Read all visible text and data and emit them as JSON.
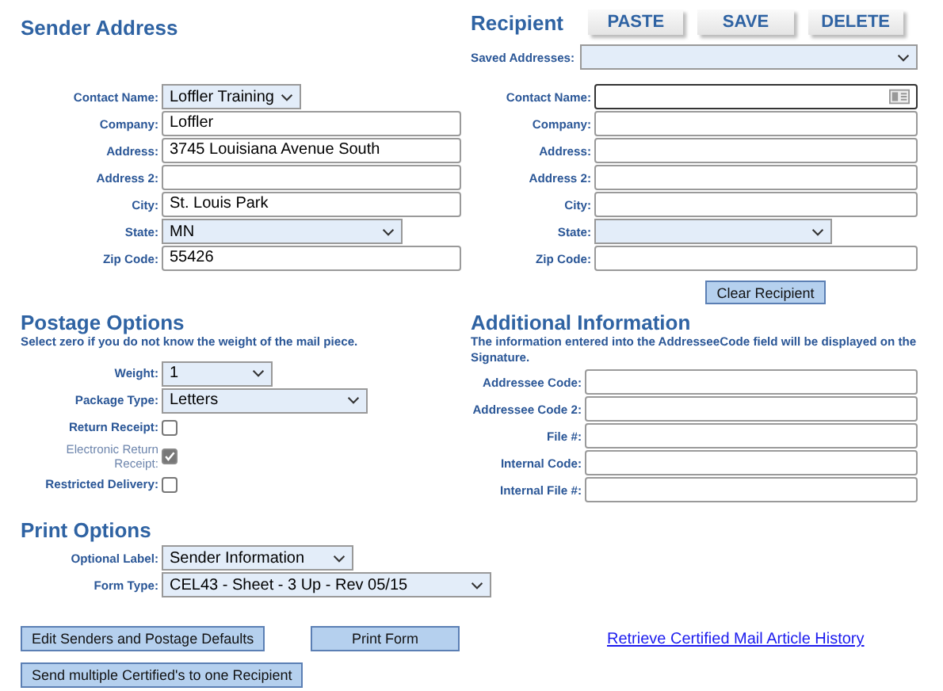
{
  "sender": {
    "title": "Sender Address",
    "fields": [
      {
        "label": "Contact Name:",
        "kind": "select",
        "value": "Loffler Training"
      },
      {
        "label": "Company:",
        "kind": "text",
        "value": "Loffler"
      },
      {
        "label": "Address:",
        "kind": "text",
        "value": "3745 Louisiana Avenue South"
      },
      {
        "label": "Address 2:",
        "kind": "text"
      },
      {
        "label": "City:",
        "kind": "text",
        "value": "St. Louis Park"
      },
      {
        "label": "State:",
        "kind": "select",
        "value": "MN"
      },
      {
        "label": "Zip Code:",
        "kind": "text",
        "value": "55426"
      }
    ]
  },
  "recipient": {
    "title": "Recipient",
    "buttons": [
      "PASTE",
      "SAVE",
      "DELETE"
    ],
    "saved_addresses": {
      "label": "Saved Addresses:"
    },
    "fields": [
      {
        "label": "Contact Name:",
        "kind": "contact"
      },
      {
        "label": "Company:",
        "kind": "text"
      },
      {
        "label": "Address:",
        "kind": "text"
      },
      {
        "label": "Address 2:",
        "kind": "text"
      },
      {
        "label": "City:",
        "kind": "text"
      },
      {
        "label": "State:",
        "kind": "select"
      },
      {
        "label": "Zip Code:",
        "kind": "text"
      }
    ],
    "clear_button": "Clear Recipient"
  },
  "postage_options": {
    "title": "Postage Options",
    "note": "Select zero if you do not know the weight of the mail piece.",
    "fields": [
      {
        "label": "Weight:",
        "kind": "select",
        "value": "1"
      },
      {
        "label": "Package Type:",
        "kind": "select",
        "value": "Letters"
      },
      {
        "label": "Return Receipt:",
        "kind": "checkbox",
        "checked": false,
        "disabled": false
      },
      {
        "label": "Electronic Return Receipt:",
        "kind": "checkbox",
        "checked": true,
        "disabled": true
      },
      {
        "label": "Restricted Delivery:",
        "kind": "checkbox",
        "checked": false,
        "disabled": false
      }
    ]
  },
  "additional_information": {
    "title": "Additional Information",
    "note": "The information entered into the AddresseeCode field will be displayed on the Signature.",
    "fields": [
      {
        "label": "Addressee Code:",
        "kind": "text"
      },
      {
        "label": "Addressee Code 2:",
        "kind": "text"
      },
      {
        "label": "File #:",
        "kind": "text"
      },
      {
        "label": "Internal Code:",
        "kind": "text"
      },
      {
        "label": "Internal File #:",
        "kind": "text"
      }
    ]
  },
  "print_options": {
    "title": "Print Options",
    "fields": [
      {
        "label": "Optional Label:",
        "kind": "select",
        "value": "Sender Information"
      },
      {
        "label": "Form Type:",
        "kind": "select",
        "value": "CEL43 - Sheet - 3 Up - Rev 05/15"
      }
    ]
  },
  "actions": [
    {
      "kind": "button",
      "label": "Edit Senders and Postage Defaults"
    },
    {
      "kind": "button",
      "label": "Print Form"
    },
    {
      "kind": "link",
      "label": "Retrieve Certified Mail Article History"
    },
    {
      "kind": "button",
      "label": "Send multiple Certified's to one Recipient"
    }
  ]
}
